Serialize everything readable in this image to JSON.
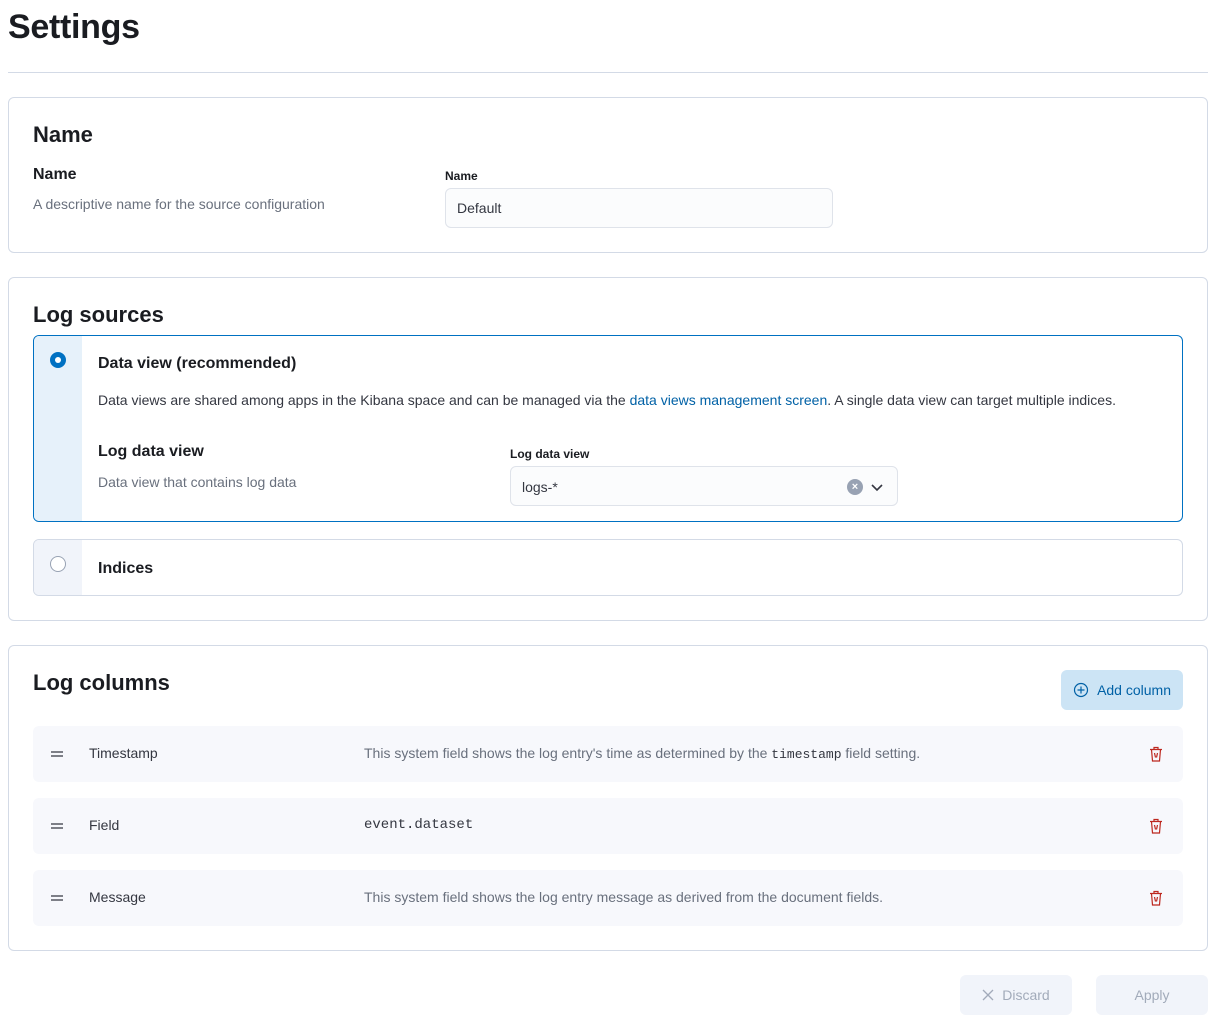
{
  "page": {
    "title": "Settings"
  },
  "name_panel": {
    "heading": "Name",
    "desc_title": "Name",
    "desc_text": "A descriptive name for the source configuration",
    "field_label": "Name",
    "field_value": "Default"
  },
  "log_sources": {
    "heading": "Log sources",
    "data_view_option": {
      "label": "Data view (recommended)",
      "body_before_link": "Data views are shared among apps in the Kibana space and can be managed via the ",
      "link_text": "data views management screen",
      "body_after_link": ". A single data view can target multiple indices.",
      "selected": true,
      "desc_title": "Log data view",
      "desc_text": "Data view that contains log data",
      "field_label": "Log data view",
      "field_value": "logs-*"
    },
    "indices_option": {
      "label": "Indices",
      "selected": false
    }
  },
  "log_columns": {
    "heading": "Log columns",
    "add_button": "Add column",
    "rows": [
      {
        "name": "Timestamp",
        "desc_before": "This system field shows the log entry's time as determined by the ",
        "desc_code": "timestamp",
        "desc_after": " field setting."
      },
      {
        "name": "Field",
        "value": "event.dataset"
      },
      {
        "name": "Message",
        "desc": "This system field shows the log entry message as derived from the document fields."
      }
    ]
  },
  "footer": {
    "discard": "Discard",
    "apply": "Apply"
  },
  "colors": {
    "primary": "#0071c2",
    "link": "#0061a6",
    "danger": "#bd271e",
    "border": "#d3dae6"
  }
}
